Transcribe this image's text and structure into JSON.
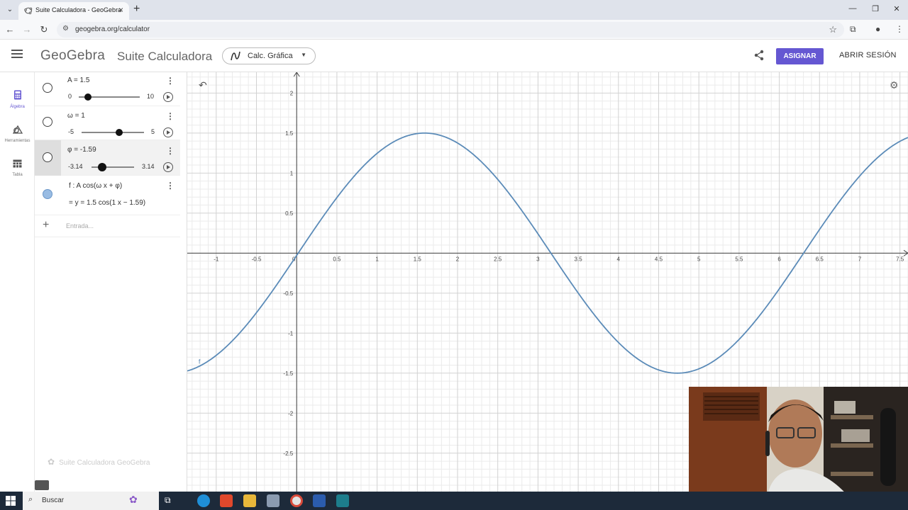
{
  "browser": {
    "tab_title": "Suite Calculadora - GeoGebra",
    "url": "geogebra.org/calculator"
  },
  "header": {
    "logo": "GeoGebra",
    "app_name": "Suite Calculadora",
    "app_switch": "Calc. Gráfica",
    "assign": "ASIGNAR",
    "sign_in": "ABRIR SESIÓN"
  },
  "rail": {
    "algebra": "Álgebra",
    "tools": "Herramientas",
    "table": "Tabla"
  },
  "algebra": {
    "sliders": [
      {
        "def": "A = 1.5",
        "min": "0",
        "max": "10",
        "value": 1.5,
        "min_value": 0,
        "max_value": 10
      },
      {
        "def": "ω = 1",
        "min": "-5",
        "max": "5",
        "value": 1,
        "min_value": -5,
        "max_value": 5
      },
      {
        "def": "φ = -1.59",
        "min": "-3.14",
        "max": "3.14",
        "value": -1.59,
        "min_value": -3.14,
        "max_value": 3.14
      }
    ],
    "function_def": "f : A  cos(ω x + φ)",
    "function_eq": "=   y = 1.5  cos(1 x − 1.59)",
    "input_placeholder": "Entrada...",
    "footer": "Suite Calculadora GeoGebra"
  },
  "graph": {
    "x_ticks": [
      "-1",
      "-0.5",
      "0",
      "0.5",
      "1",
      "1.5",
      "2",
      "2.5",
      "3",
      "3.5",
      "4",
      "4.5",
      "5",
      "5.5",
      "6",
      "6.5",
      "7",
      "7.5"
    ],
    "y_ticks": [
      "2",
      "1.5",
      "1",
      "0.5",
      "-0.5",
      "-1",
      "-1.5",
      "-2",
      "-2.5"
    ],
    "function_label": "f",
    "x_range": [
      -1.36,
      7.6
    ],
    "y_range": [
      -2.98,
      2.26
    ],
    "amplitude": 1.5,
    "omega": 1,
    "phase": -1.59,
    "curve_color": "#5b8bb8"
  },
  "taskbar": {
    "search": "Buscar"
  },
  "colors": {
    "accent": "#6557d2",
    "grid_minor": "#ebebeb",
    "grid_major": "#d2d2d2"
  }
}
